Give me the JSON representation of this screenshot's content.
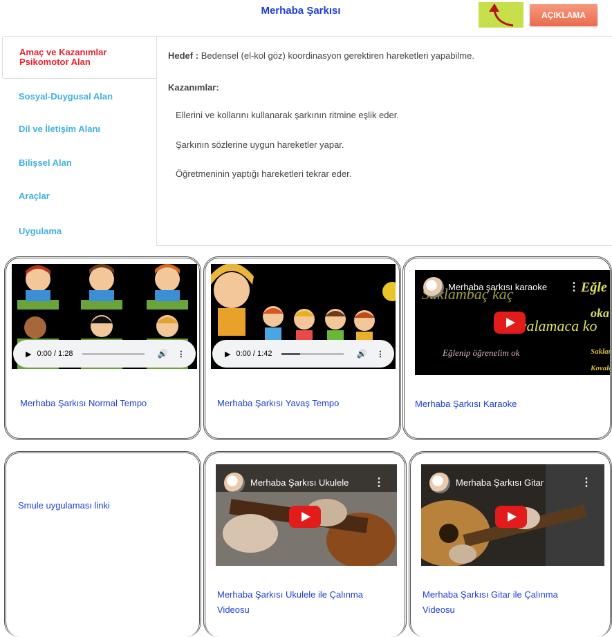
{
  "header": {
    "title": "Merhaba Şarkısı",
    "back_icon": "curved-arrow-back-icon",
    "aciklama_label": "AÇIKLAMA"
  },
  "tabs": [
    {
      "label_line1": "Amaç ve Kazanımlar",
      "label_line2": "Psikomotor Alan",
      "active": true
    },
    {
      "label": "Sosyal-Duygusal Alan"
    },
    {
      "label": "Dil ve İletişim Alanı"
    },
    {
      "label": "Bilişsel Alan"
    },
    {
      "label": "Araçlar"
    },
    {
      "label": "Uygulama"
    }
  ],
  "content": {
    "hedef_label": "Hedef :",
    "hedef_text": "Bedensel (el-kol göz) koordinasyon gerektiren hareketleri yapabilme.",
    "kazanimlar_label": "Kazanımlar:",
    "kazanimlar": [
      "Ellerini ve kollarını kullanarak şarkının ritmine eşlik eder.",
      "Şarkının sözlerine uygun hareketler yapar.",
      "Öğretmeninin yaptığı hareketleri tekrar eder."
    ]
  },
  "cards": [
    {
      "link": "Merhaba Şarkısı Normal Tempo",
      "audio_time": "0:00 / 1:28",
      "audio_progress": 0.0
    },
    {
      "link": "Merhaba Şarkısı Yavaş Tempo",
      "audio_time": "0:00 / 1:42",
      "audio_progress": 0.3
    },
    {
      "link": "Merhaba Şarkısı Karaoke",
      "video_title": "Merhaba şarkısı karaoke",
      "overlay_1": "Kovalamaca ko",
      "overlay_2": "Eğlenip öğrenelim ok",
      "overlay_3": "Saklambaç kaç",
      "overlay_4": "Eğle",
      "overlay_5": "oka",
      "overlay_6": "Saklam",
      "overlay_7": "Kovala"
    },
    {
      "link": "Smule uygulaması linki"
    },
    {
      "link_line1": "Merhaba Şarkısı Ukulele ile Çalınma",
      "link_line2": "Videosu",
      "video_title": "Merhaba Şarkısı Ukulele"
    },
    {
      "link_line1": "Merhaba Şarkısı Gitar ile Çalınma",
      "link_line2": "Videosu",
      "video_title": "Merhaba Şarkısı Gitar"
    }
  ],
  "colors": {
    "title_blue": "#1b3fd6",
    "tab_blue": "#41b0e0",
    "active_red": "#e8222a",
    "back_green": "#c6df4a",
    "aciklama_orange": "#ea6b4d"
  }
}
